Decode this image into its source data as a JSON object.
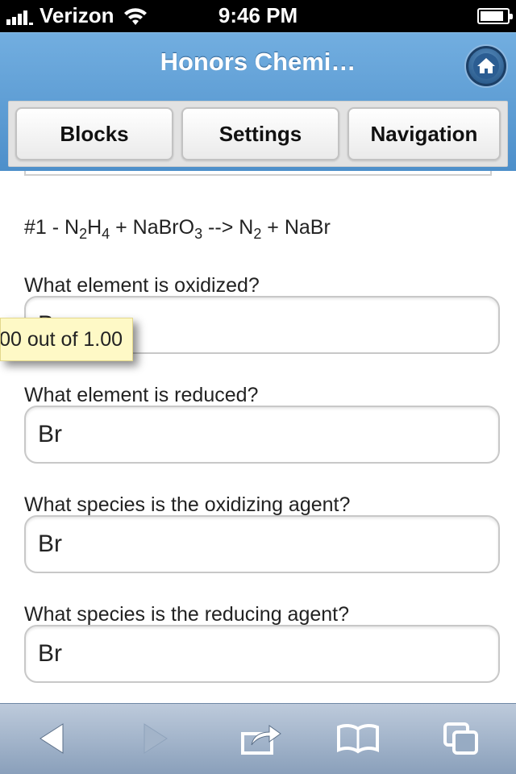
{
  "status_bar": {
    "carrier": "Verizon",
    "time": "9:46 PM"
  },
  "header": {
    "title": "Honors Chemi…",
    "nav": {
      "blocks": "Blocks",
      "settings": "Settings",
      "navigation": "Navigation"
    }
  },
  "question": {
    "number_prefix": "#1 - N",
    "eq_parts": [
      "2",
      "H",
      "4",
      " + NaBrO",
      "3",
      " --> N",
      "2",
      " + NaBr"
    ],
    "items": [
      {
        "label": "What element is oxidized?",
        "value": "B"
      },
      {
        "label": "What element is reduced?",
        "value": "Br"
      },
      {
        "label": "What species is the oxidizing agent?",
        "value": "Br"
      },
      {
        "label": "What species is the reducing agent?",
        "value": "Br"
      }
    ],
    "tooltip": "00 out of 1.00"
  },
  "toolbar": {
    "icons": [
      "back-icon",
      "forward-icon",
      "share-icon",
      "bookmarks-icon",
      "tabs-icon"
    ]
  },
  "colors": {
    "header_top": "#72aee0",
    "header_bottom": "#4d8fca",
    "tooltip_bg": "#fef9c6",
    "toolbar": "#9fb2c9"
  }
}
